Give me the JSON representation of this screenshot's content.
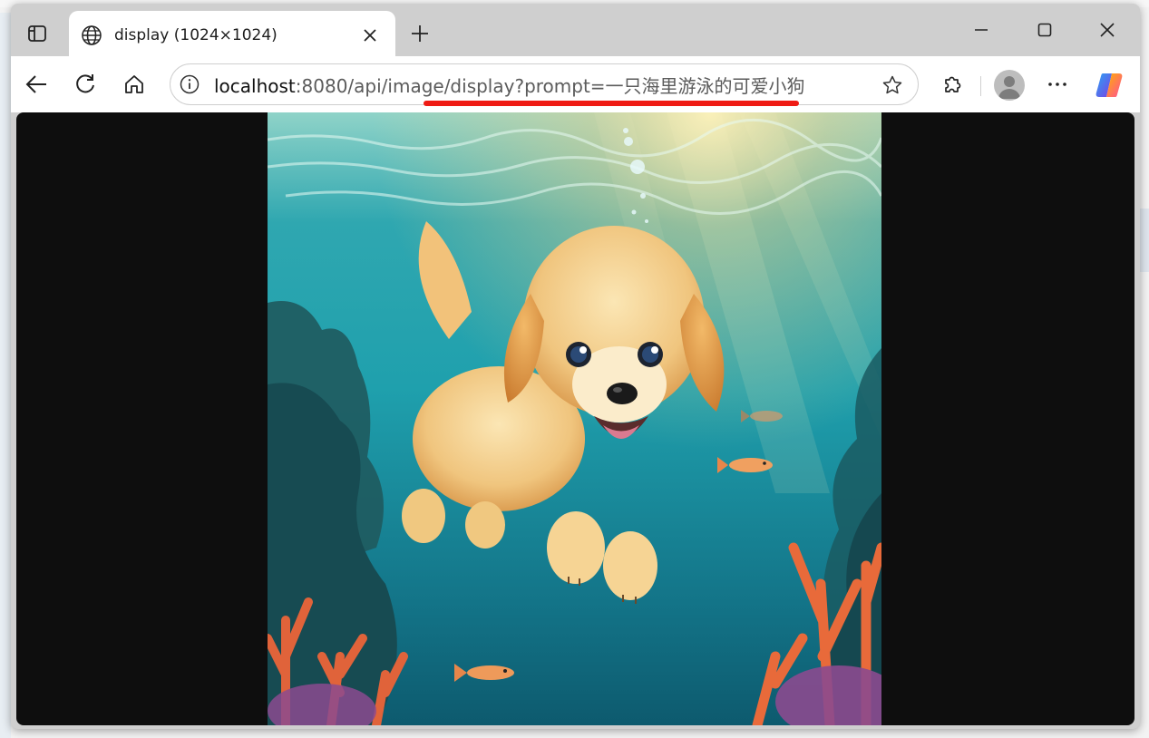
{
  "browser": {
    "tab": {
      "title": "display (1024×1024)"
    },
    "address": {
      "host": "localhost",
      "path": ":8080/api/image/display?prompt=一只海里游泳的可爱小狗"
    }
  },
  "content": {
    "image": {
      "alt": "一只海里游泳的可爱小狗"
    }
  },
  "icons": [
    "tab-actions-icon",
    "globe-icon",
    "close-icon",
    "plus-icon",
    "minimize-icon",
    "maximize-icon",
    "window-close-icon",
    "back-icon",
    "refresh-icon",
    "home-icon",
    "info-icon",
    "star-icon",
    "extensions-icon",
    "avatar",
    "more-icon",
    "copilot-icon"
  ],
  "colors": {
    "highlight_underline": "#ef1b14",
    "tab_strip": "#cfcfcf"
  }
}
